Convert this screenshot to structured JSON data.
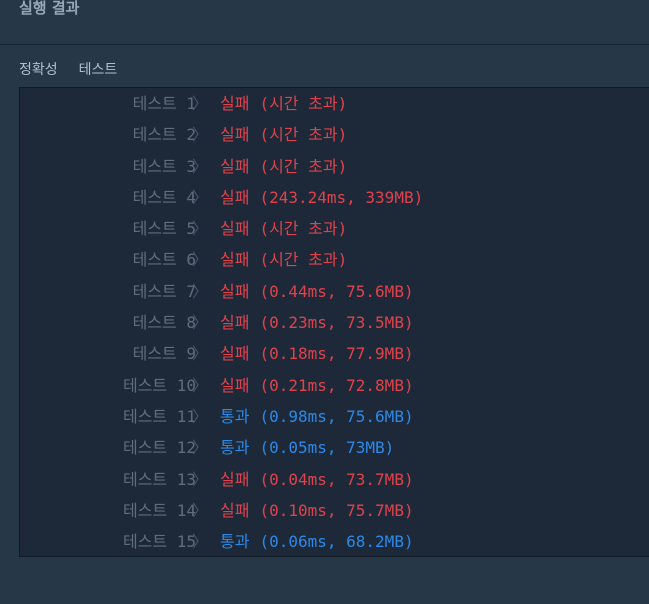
{
  "header": {
    "title": "실행 결과"
  },
  "tabs": [
    {
      "label": "정확성"
    },
    {
      "label": "테스트"
    }
  ],
  "tests": [
    {
      "name": "테스트 1",
      "status": "실패",
      "result": "(시간 초과)",
      "passed": false
    },
    {
      "name": "테스트 2",
      "status": "실패",
      "result": "(시간 초과)",
      "passed": false
    },
    {
      "name": "테스트 3",
      "status": "실패",
      "result": "(시간 초과)",
      "passed": false
    },
    {
      "name": "테스트 4",
      "status": "실패",
      "result": "(243.24ms, 339MB)",
      "passed": false
    },
    {
      "name": "테스트 5",
      "status": "실패",
      "result": "(시간 초과)",
      "passed": false
    },
    {
      "name": "테스트 6",
      "status": "실패",
      "result": "(시간 초과)",
      "passed": false
    },
    {
      "name": "테스트 7",
      "status": "실패",
      "result": "(0.44ms, 75.6MB)",
      "passed": false
    },
    {
      "name": "테스트 8",
      "status": "실패",
      "result": "(0.23ms, 73.5MB)",
      "passed": false
    },
    {
      "name": "테스트 9",
      "status": "실패",
      "result": "(0.18ms, 77.9MB)",
      "passed": false
    },
    {
      "name": "테스트 10",
      "status": "실패",
      "result": "(0.21ms, 72.8MB)",
      "passed": false
    },
    {
      "name": "테스트 11",
      "status": "통과",
      "result": "(0.98ms, 75.6MB)",
      "passed": true
    },
    {
      "name": "테스트 12",
      "status": "통과",
      "result": "(0.05ms, 73MB)",
      "passed": true
    },
    {
      "name": "테스트 13",
      "status": "실패",
      "result": "(0.04ms, 73.7MB)",
      "passed": false
    },
    {
      "name": "테스트 14",
      "status": "실패",
      "result": "(0.10ms, 75.7MB)",
      "passed": false
    },
    {
      "name": "테스트 15",
      "status": "통과",
      "result": "(0.06ms, 68.2MB)",
      "passed": true
    }
  ],
  "colors": {
    "background": "#263747",
    "console": "#1d2939",
    "fail": "#e0424b",
    "pass": "#2c89e8",
    "test_name": "#5e6d7c"
  },
  "icons": {
    "row_separator": "chevron-right-icon"
  }
}
